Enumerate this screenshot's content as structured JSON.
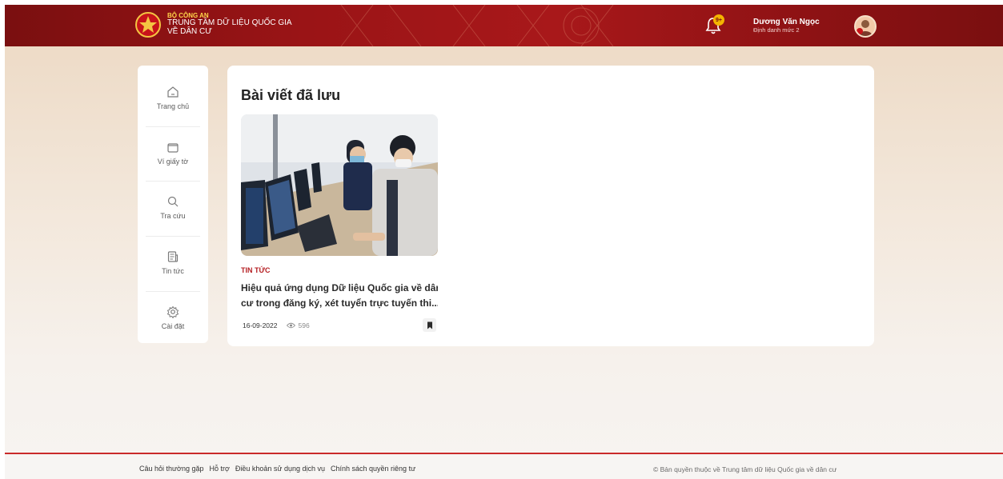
{
  "header": {
    "org_name": "BỘ CÔNG AN",
    "brand_line1": "TRUNG TÂM DỮ LIỆU QUỐC GIA",
    "brand_line2": "VỀ DÂN CƯ",
    "notification_badge": "9+",
    "user_name": "Dương Văn Ngọc",
    "user_level": "Định danh mức 2"
  },
  "sidebar": {
    "items": [
      {
        "label": "Trang chủ",
        "icon": "home-icon"
      },
      {
        "label": "Ví giấy tờ",
        "icon": "wallet-icon"
      },
      {
        "label": "Tra cứu",
        "icon": "search-icon"
      },
      {
        "label": "Tin tức",
        "icon": "news-icon"
      },
      {
        "label": "Cài đặt",
        "icon": "gear-icon"
      }
    ]
  },
  "main": {
    "title": "Bài viết đã lưu",
    "articles": [
      {
        "category": "TIN TỨC",
        "title_line1": "Hiệu quả ứng dụng Dữ liệu Quốc gia về dân",
        "title_line2": "cư trong đăng ký, xét tuyển trực tuyến thi...",
        "date": "16-09-2022",
        "views": "596"
      }
    ]
  },
  "footer": {
    "links": [
      "Câu hỏi thường gặp",
      "Hỗ trợ",
      "Điều khoản sử dụng dịch vụ",
      "Chính sách quyền riêng tư"
    ],
    "copyright": "© Bản quyền thuộc về Trung tâm dữ liệu Quốc gia về dân cư"
  },
  "colors": {
    "header_red": "#9a1416",
    "accent_red": "#b51f23",
    "gold": "#ffd54a"
  }
}
